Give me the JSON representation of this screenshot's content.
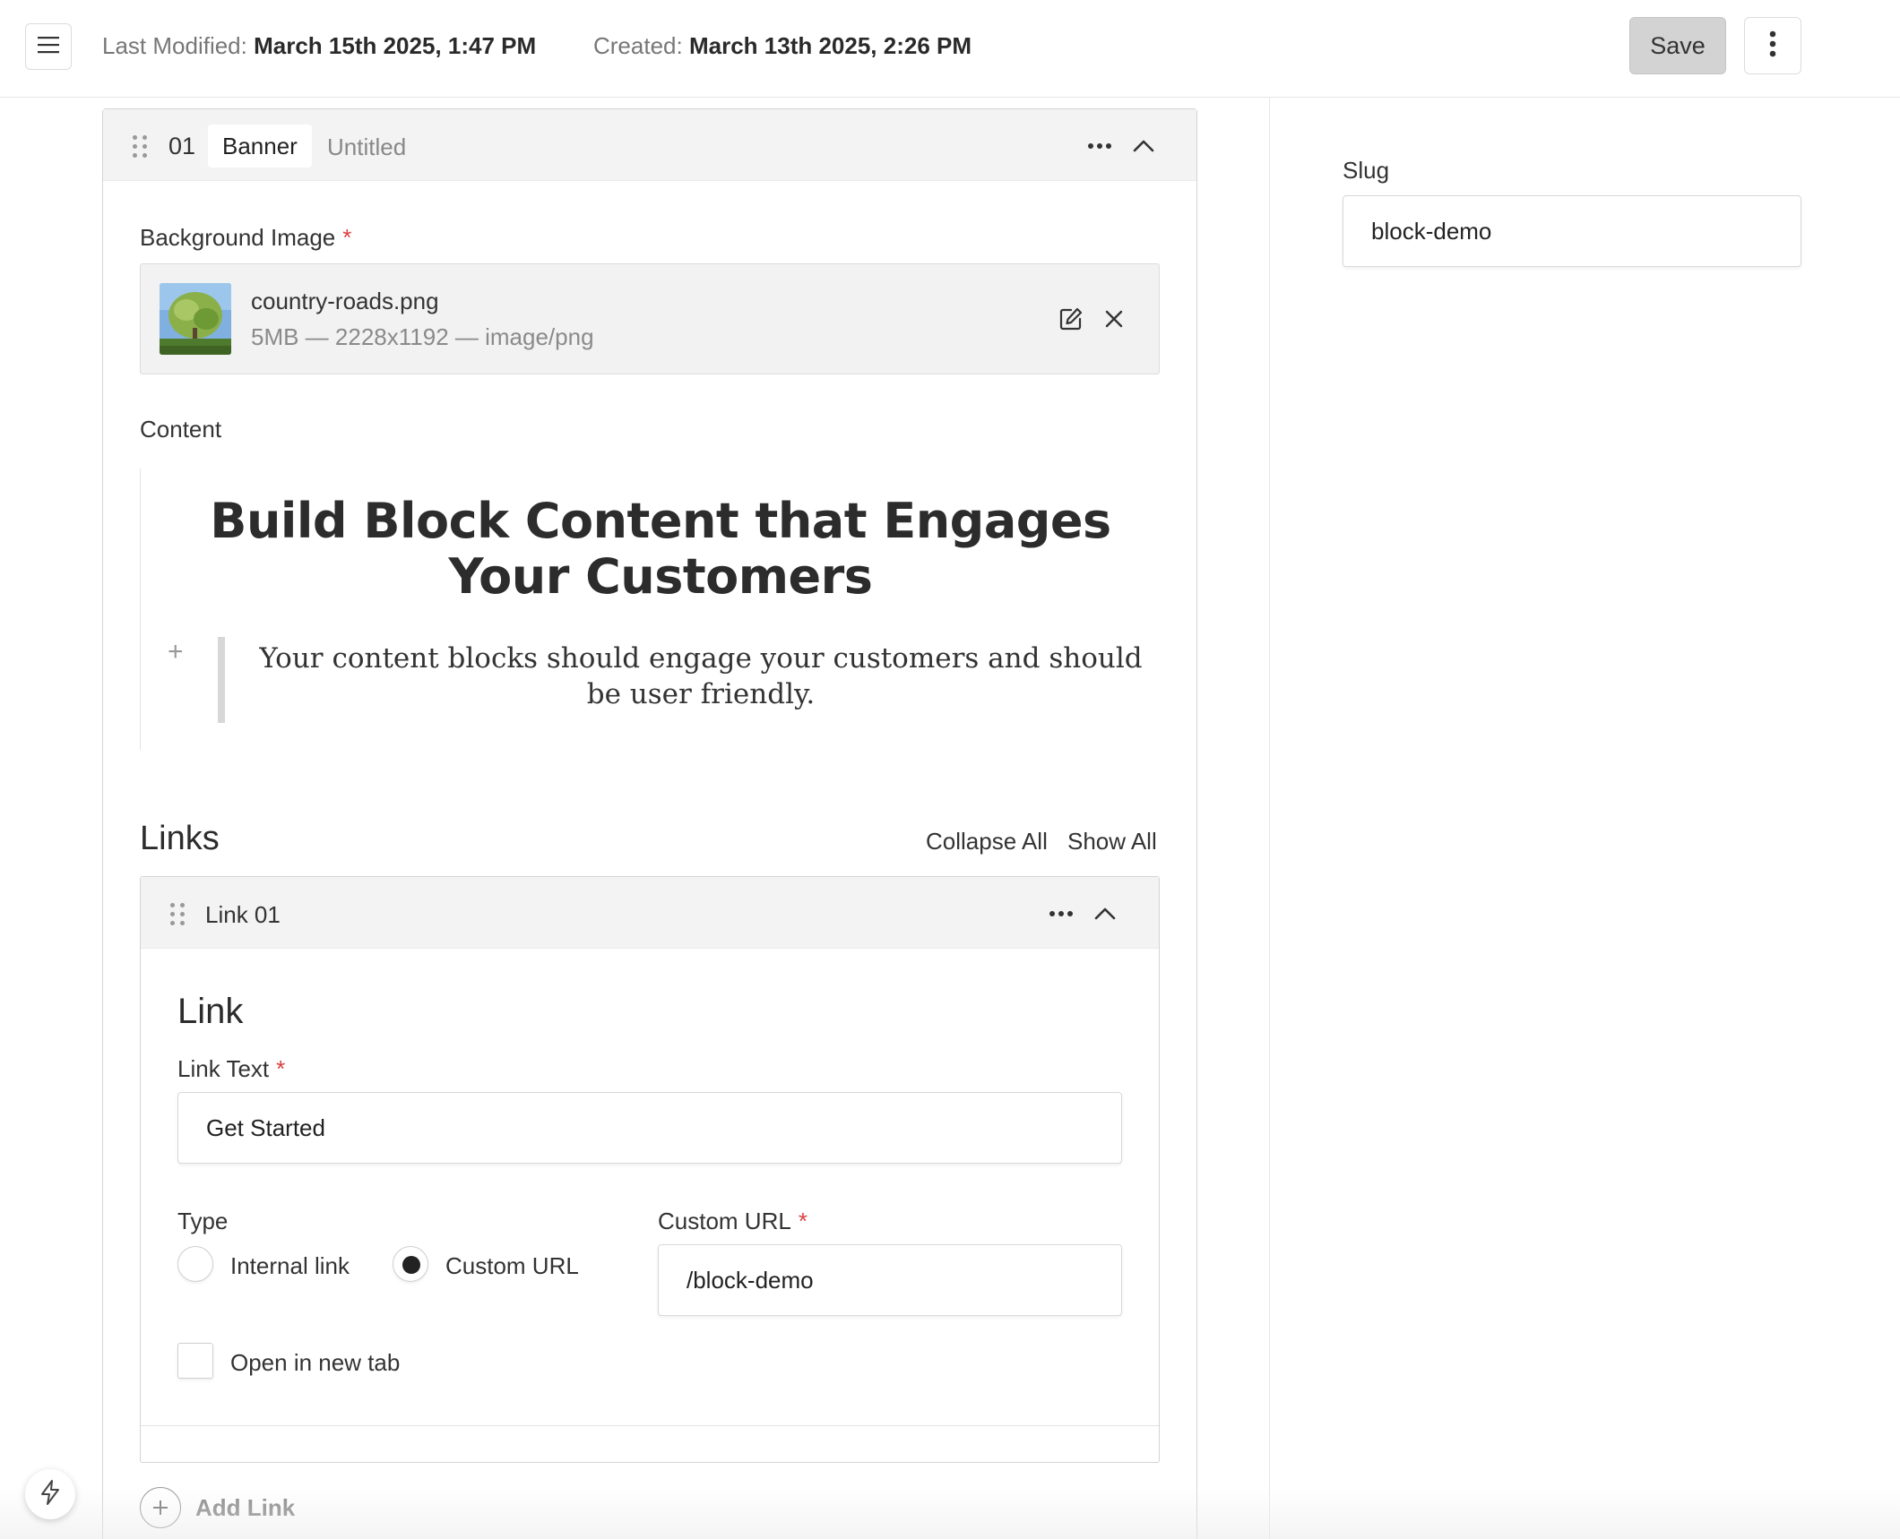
{
  "header": {
    "last_modified_label": "Last Modified:",
    "last_modified_value": "March 15th 2025, 1:47 PM",
    "created_label": "Created:",
    "created_value": "March 13th 2025, 2:26 PM",
    "save_label": "Save"
  },
  "sidebar": {
    "slug_label": "Slug",
    "slug_value": "block-demo"
  },
  "block": {
    "number": "01",
    "type": "Banner",
    "title": "Untitled",
    "background_image": {
      "label": "Background Image",
      "required_mark": "*",
      "file_name": "country-roads.png",
      "file_meta": "5MB — 2228x1192 — image/png"
    },
    "content": {
      "label": "Content",
      "heading": "Build Block Content that Engages Your Customers",
      "quote": "Your content blocks should engage your customers and should be user friendly.",
      "plus": "+"
    },
    "links": {
      "title": "Links",
      "collapse_all": "Collapse All",
      "show_all": "Show All",
      "items": [
        {
          "title": "Link 01",
          "heading": "Link",
          "link_text_label": "Link Text",
          "link_text_value": "Get Started",
          "type_label": "Type",
          "type_options": [
            "Internal link",
            "Custom URL"
          ],
          "type_selected": "Custom URL",
          "custom_url_label": "Custom URL",
          "custom_url_value": "/block-demo",
          "new_tab_label": "Open in new tab",
          "new_tab_checked": false
        }
      ],
      "add_label": "Add Link"
    }
  },
  "icons": {
    "menu": "hamburger-icon",
    "kebab": "vertical-dots-icon",
    "drag": "drag-handle-icon",
    "more": "horizontal-dots-icon",
    "collapse": "chevron-up-icon",
    "edit": "edit-icon",
    "remove": "close-icon",
    "add": "plus-circle-icon",
    "bolt": "lightning-icon"
  },
  "colors": {
    "required": "#d93f3f",
    "save_bg": "#d3d3d3",
    "header_bg": "#f3f3f3"
  }
}
